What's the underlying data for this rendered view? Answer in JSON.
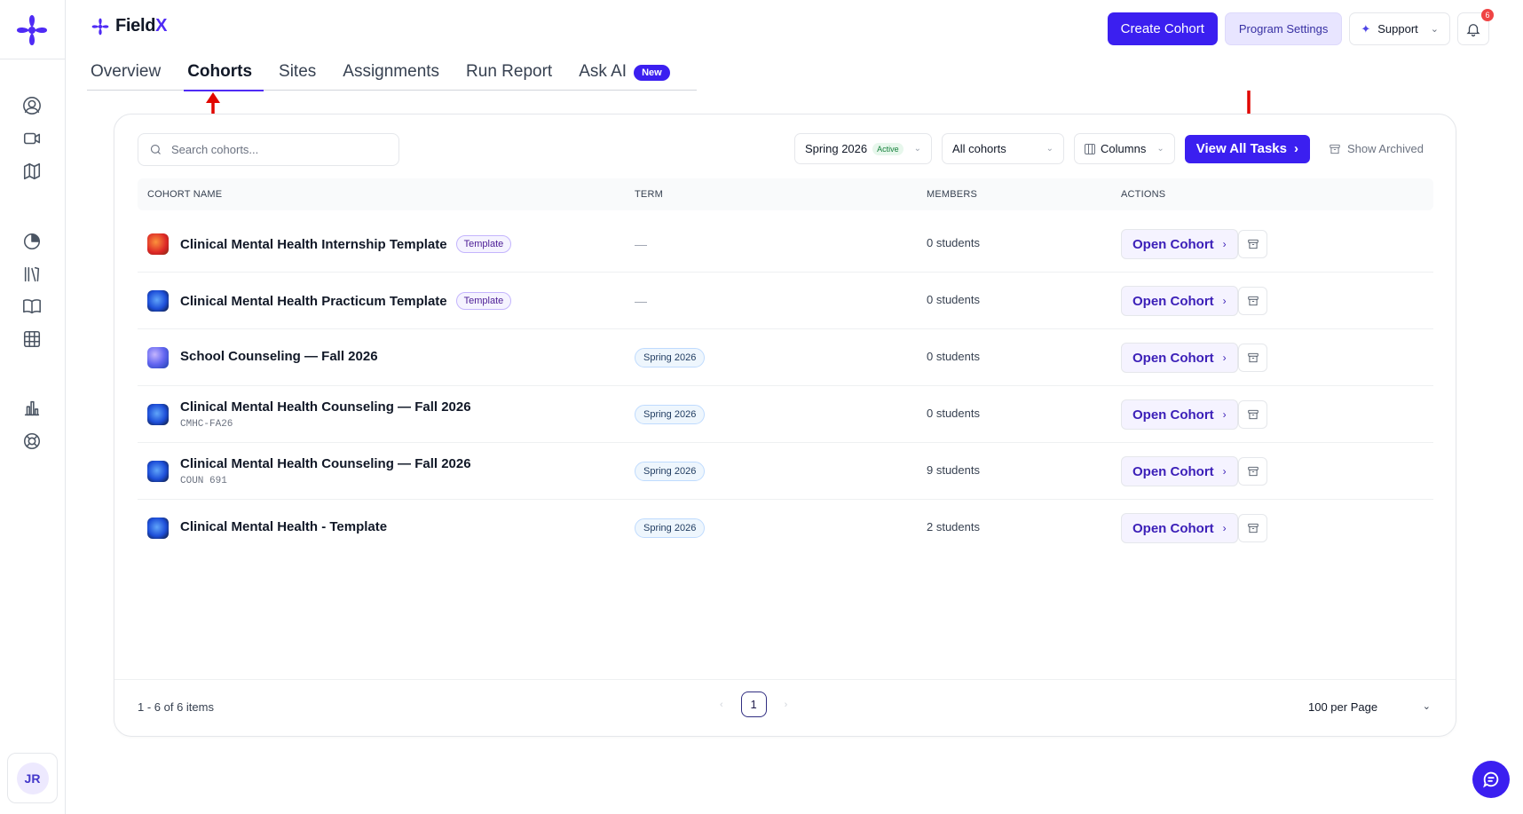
{
  "brand": {
    "prefix": "Field",
    "suffix": "X"
  },
  "header": {
    "create_cohort": "Create Cohort",
    "program_settings": "Program Settings",
    "support": "Support",
    "notification_count": "6"
  },
  "tabs": [
    {
      "label": "Overview",
      "active": false
    },
    {
      "label": "Cohorts",
      "active": true
    },
    {
      "label": "Sites",
      "active": false
    },
    {
      "label": "Assignments",
      "active": false
    },
    {
      "label": "Run Report",
      "active": false
    },
    {
      "label": "Ask AI",
      "active": false,
      "badge": "New"
    }
  ],
  "toolbar": {
    "search_placeholder": "Search cohorts...",
    "term_select": "Spring 2026",
    "term_status": "Active",
    "cohort_filter": "All cohorts",
    "columns": "Columns",
    "view_all_tasks": "View All Tasks",
    "show_archived": "Show Archived"
  },
  "table": {
    "headers": {
      "name": "COHORT NAME",
      "term": "TERM",
      "members": "MEMBERS",
      "actions": "ACTIONS"
    },
    "open_label": "Open Cohort",
    "rows": [
      {
        "name": "Clinical Mental Health Internship Template",
        "tag": "Template",
        "code": "",
        "term": "",
        "term_empty": "—",
        "members": "0 students",
        "thumb": "orange"
      },
      {
        "name": "Clinical Mental Health Practicum Template",
        "tag": "Template",
        "code": "",
        "term": "",
        "term_empty": "—",
        "members": "0 students",
        "thumb": "blue"
      },
      {
        "name": "School Counseling — Fall 2026",
        "tag": "",
        "code": "",
        "term": "Spring 2026",
        "members": "0 students",
        "thumb": "purple"
      },
      {
        "name": "Clinical Mental Health Counseling — Fall 2026",
        "tag": "",
        "code": "CMHC-FA26",
        "term": "Spring 2026",
        "members": "0 students",
        "thumb": "blue"
      },
      {
        "name": "Clinical Mental Health Counseling — Fall 2026",
        "tag": "",
        "code": "COUN 691",
        "term": "Spring 2026",
        "members": "9 students",
        "thumb": "blue"
      },
      {
        "name": "Clinical Mental Health - Template",
        "tag": "",
        "code": "",
        "term": "Spring 2026",
        "members": "2 students",
        "thumb": "blue"
      }
    ]
  },
  "footer": {
    "items_count": "1 - 6 of 6 items",
    "current_page": "1",
    "per_page": "100 per Page"
  },
  "user": {
    "initials": "JR"
  },
  "colors": {
    "brand": "#3b1ff0",
    "annotation": "#e10600"
  }
}
